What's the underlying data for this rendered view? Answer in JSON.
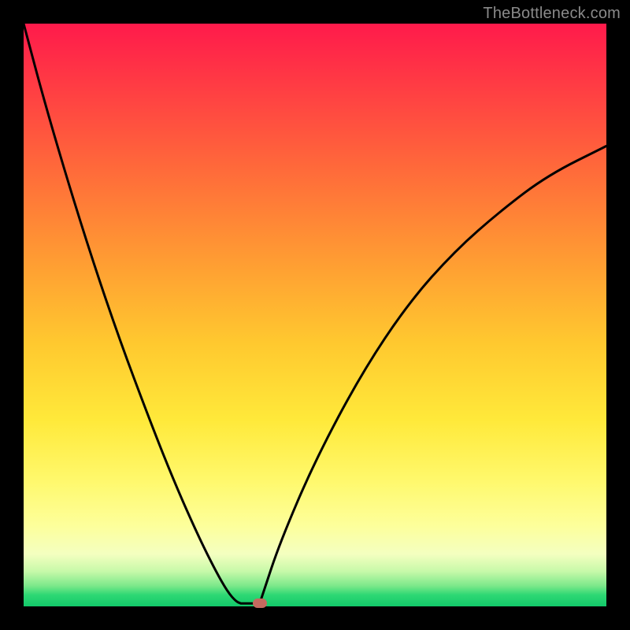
{
  "watermark": "TheBottleneck.com",
  "chart_data": {
    "type": "line",
    "title": "",
    "xlabel": "",
    "ylabel": "",
    "xlim": [
      0,
      100
    ],
    "ylim": [
      0,
      100
    ],
    "grid": false,
    "legend": false,
    "background_gradient": [
      "#ff1a4b",
      "#ff9a33",
      "#ffe93a",
      "#fdff9a",
      "#12c96a"
    ],
    "series": [
      {
        "name": "left-branch",
        "x": [
          0,
          4,
          10,
          16,
          22,
          26,
          30,
          33,
          35,
          36.5,
          37.3,
          37.3
        ],
        "values": [
          100,
          85,
          65,
          47,
          31,
          21,
          12,
          6,
          2.5,
          0.8,
          0.5,
          0.5
        ]
      },
      {
        "name": "floor",
        "x": [
          37.3,
          40.5
        ],
        "values": [
          0.5,
          0.5
        ]
      },
      {
        "name": "right-branch",
        "x": [
          40.5,
          41,
          44,
          50,
          58,
          66,
          74,
          82,
          90,
          100
        ],
        "values": [
          0.5,
          2,
          11,
          25,
          40,
          52,
          61,
          68,
          74,
          79
        ]
      }
    ],
    "marker": {
      "x": 40.5,
      "y": 0.5,
      "color": "#c4695f"
    }
  }
}
